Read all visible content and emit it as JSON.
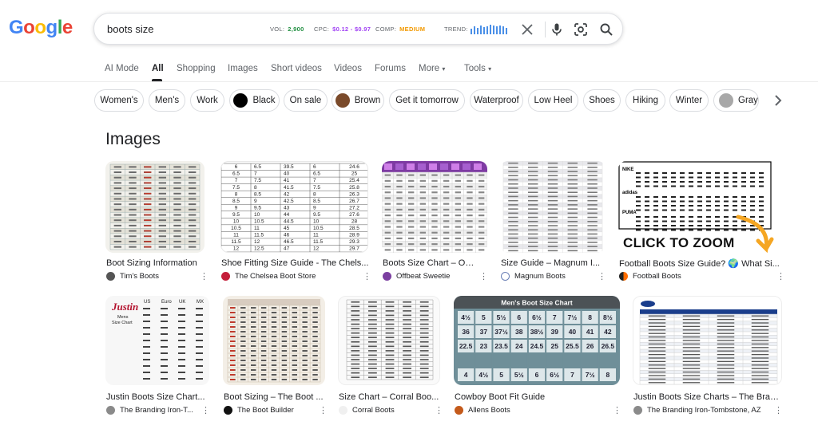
{
  "logo": {
    "g1": "G",
    "o1": "o",
    "o2": "o",
    "g2": "g",
    "l": "l",
    "e": "e"
  },
  "search": {
    "query": "boots size",
    "vol_label": "VOL:",
    "vol_value": "2,900",
    "cpc_label": "CPC:",
    "cpc_value": "$0.12 - $0.97",
    "comp_label": "COMP:",
    "comp_value": "MEDIUM",
    "trend_label": "TREND:",
    "trend_bars": [
      0.55,
      0.8,
      0.65,
      0.9,
      0.75,
      0.85,
      1.0,
      0.9,
      0.8,
      0.95,
      0.85,
      0.7
    ],
    "colors": {
      "vol": "#1e8e3e",
      "cpc": "#a142f4",
      "comp": "#f29900",
      "trend": "#4a8fe7"
    }
  },
  "tabs": [
    "AI Mode",
    "All",
    "Shopping",
    "Images",
    "Short videos",
    "Videos",
    "Forums",
    "More",
    "Tools"
  ],
  "active_tab": "All",
  "chips": [
    {
      "label": "Women's"
    },
    {
      "label": "Men's"
    },
    {
      "label": "Work"
    },
    {
      "label": "Black",
      "swatch": "#000000"
    },
    {
      "label": "On sale"
    },
    {
      "label": "Brown",
      "swatch": "#7a4a2a"
    },
    {
      "label": "Get it tomorrow"
    },
    {
      "label": "Waterproof"
    },
    {
      "label": "Low Heel"
    },
    {
      "label": "Shoes"
    },
    {
      "label": "Hiking"
    },
    {
      "label": "Winter"
    },
    {
      "label": "Gray",
      "swatch": "#a8a8a8"
    }
  ],
  "images": {
    "title": "Images",
    "row1": [
      {
        "caption": "Boot Sizing Information",
        "source": "Tim's Boots"
      },
      {
        "caption": "Shoe Fitting Size Guide - The Chels...",
        "source": "The Chelsea Boot Store"
      },
      {
        "caption": "Boots Size Chart – Offb...",
        "source": "Offbeat Sweetie"
      },
      {
        "caption": "Size Guide – Magnum I...",
        "source": "Magnum Boots"
      },
      {
        "caption": "Football Boots Size Guide? 🌍 What Si...",
        "source": "Football Boots"
      }
    ],
    "row2": [
      {
        "caption": "Justin Boots Size Chart...",
        "source": "The Branding Iron-T..."
      },
      {
        "caption": "Boot Sizing – The Boot ...",
        "source": "The Boot Builder"
      },
      {
        "caption": "Size Chart – Corral Boo...",
        "source": "Corral Boots"
      },
      {
        "caption": "Cowboy Boot Fit Guide",
        "source": "Allens Boots"
      },
      {
        "caption": "Justin Boots Size Charts – The Bran...",
        "source": "The Branding Iron-Tombstone, AZ"
      }
    ],
    "thumb_text": {
      "chelsea_rows": [
        [
          "6",
          "6.5",
          "39.5",
          "6",
          "24.6"
        ],
        [
          "6.5",
          "7",
          "40",
          "6.5",
          "25"
        ],
        [
          "7",
          "7.5",
          "41",
          "7",
          "25.4"
        ],
        [
          "7.5",
          "8",
          "41.5",
          "7.5",
          "25.8"
        ],
        [
          "8",
          "8.5",
          "42",
          "8",
          "26.3"
        ],
        [
          "8.5",
          "9",
          "42.5",
          "8.5",
          "26.7"
        ],
        [
          "9",
          "9.5",
          "43",
          "9",
          "27.2"
        ],
        [
          "9.5",
          "10",
          "44",
          "9.5",
          "27.6"
        ],
        [
          "10",
          "10.5",
          "44.5",
          "10",
          "28"
        ],
        [
          "10.5",
          "11",
          "45",
          "10.5",
          "28.5"
        ],
        [
          "11",
          "11.5",
          "46",
          "11",
          "28.9"
        ],
        [
          "11.5",
          "12",
          "46.5",
          "11.5",
          "29.3"
        ],
        [
          "12",
          "12.5",
          "47",
          "12",
          "29.7"
        ]
      ],
      "click_to_zoom": "CLICK TO ZOOM",
      "nike": "NIKE",
      "adidas": "adidas",
      "puma": "PUMA",
      "cowboy_title": "Men's Boot Size Chart",
      "cowboy_rows": [
        [
          "4½",
          "5",
          "5½",
          "6",
          "6½",
          "7",
          "7½",
          "8",
          "8½"
        ],
        [
          "36",
          "37",
          "37½",
          "38",
          "38½",
          "39",
          "40",
          "41",
          "42"
        ],
        [
          "22.5",
          "23",
          "23.5",
          "24",
          "24.5",
          "25",
          "25.5",
          "26",
          "26.5"
        ],
        [
          "",
          "",
          "",
          "",
          "",
          "",
          "",
          "",
          ""
        ],
        [
          "4",
          "4½",
          "5",
          "5½",
          "6",
          "6½",
          "7",
          "7½",
          "8"
        ]
      ],
      "justin_logo": "Justin",
      "justin_sub1": "Mens",
      "justin_sub2": "Size Chart",
      "justin_cols": [
        "US",
        "Euro",
        "UK",
        "MX"
      ]
    }
  }
}
